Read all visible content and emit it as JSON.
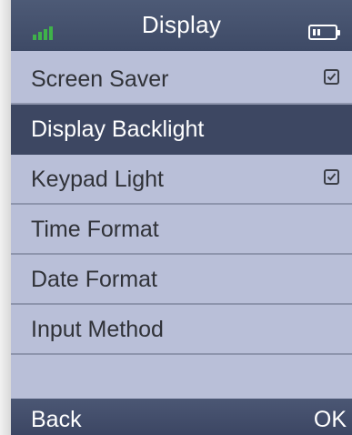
{
  "header": {
    "title": "Display",
    "signal_icon": "signal-bars-icon",
    "battery_icon": "battery-icon"
  },
  "menu": {
    "items": [
      {
        "label": "Screen Saver",
        "checked": true
      },
      {
        "label": "Display Backlight",
        "selected": true
      },
      {
        "label": "Keypad Light",
        "checked": true
      },
      {
        "label": "Time Format"
      },
      {
        "label": "Date Format"
      },
      {
        "label": "Input Method"
      }
    ]
  },
  "softkeys": {
    "left": "Back",
    "right": "OK"
  },
  "colors": {
    "statusbar": "#44506c",
    "screen": "#b9bfd8",
    "selected": "#3d4762",
    "signal": "#3fb24a"
  }
}
